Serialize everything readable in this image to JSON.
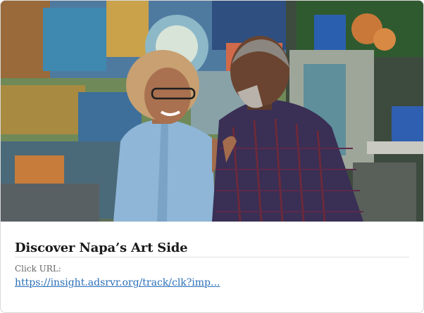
{
  "ad": {
    "image_alt": "Smiling couple in front of a colorful mural",
    "title": "Discover Napa’s Art Side",
    "click_url_label": "Click URL:",
    "click_url_text": "https://insight.adsrvr.org/track/clk?imp..."
  }
}
